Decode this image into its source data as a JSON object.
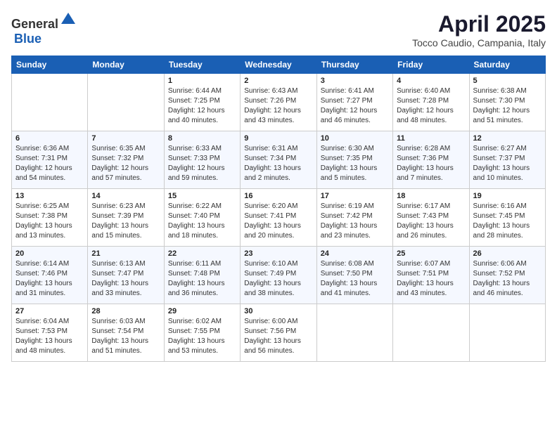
{
  "header": {
    "logo_general": "General",
    "logo_blue": "Blue",
    "month": "April 2025",
    "location": "Tocco Caudio, Campania, Italy"
  },
  "weekdays": [
    "Sunday",
    "Monday",
    "Tuesday",
    "Wednesday",
    "Thursday",
    "Friday",
    "Saturday"
  ],
  "weeks": [
    [
      {
        "day": "",
        "info": ""
      },
      {
        "day": "",
        "info": ""
      },
      {
        "day": "1",
        "info": "Sunrise: 6:44 AM\nSunset: 7:25 PM\nDaylight: 12 hours and 40 minutes."
      },
      {
        "day": "2",
        "info": "Sunrise: 6:43 AM\nSunset: 7:26 PM\nDaylight: 12 hours and 43 minutes."
      },
      {
        "day": "3",
        "info": "Sunrise: 6:41 AM\nSunset: 7:27 PM\nDaylight: 12 hours and 46 minutes."
      },
      {
        "day": "4",
        "info": "Sunrise: 6:40 AM\nSunset: 7:28 PM\nDaylight: 12 hours and 48 minutes."
      },
      {
        "day": "5",
        "info": "Sunrise: 6:38 AM\nSunset: 7:30 PM\nDaylight: 12 hours and 51 minutes."
      }
    ],
    [
      {
        "day": "6",
        "info": "Sunrise: 6:36 AM\nSunset: 7:31 PM\nDaylight: 12 hours and 54 minutes."
      },
      {
        "day": "7",
        "info": "Sunrise: 6:35 AM\nSunset: 7:32 PM\nDaylight: 12 hours and 57 minutes."
      },
      {
        "day": "8",
        "info": "Sunrise: 6:33 AM\nSunset: 7:33 PM\nDaylight: 12 hours and 59 minutes."
      },
      {
        "day": "9",
        "info": "Sunrise: 6:31 AM\nSunset: 7:34 PM\nDaylight: 13 hours and 2 minutes."
      },
      {
        "day": "10",
        "info": "Sunrise: 6:30 AM\nSunset: 7:35 PM\nDaylight: 13 hours and 5 minutes."
      },
      {
        "day": "11",
        "info": "Sunrise: 6:28 AM\nSunset: 7:36 PM\nDaylight: 13 hours and 7 minutes."
      },
      {
        "day": "12",
        "info": "Sunrise: 6:27 AM\nSunset: 7:37 PM\nDaylight: 13 hours and 10 minutes."
      }
    ],
    [
      {
        "day": "13",
        "info": "Sunrise: 6:25 AM\nSunset: 7:38 PM\nDaylight: 13 hours and 13 minutes."
      },
      {
        "day": "14",
        "info": "Sunrise: 6:23 AM\nSunset: 7:39 PM\nDaylight: 13 hours and 15 minutes."
      },
      {
        "day": "15",
        "info": "Sunrise: 6:22 AM\nSunset: 7:40 PM\nDaylight: 13 hours and 18 minutes."
      },
      {
        "day": "16",
        "info": "Sunrise: 6:20 AM\nSunset: 7:41 PM\nDaylight: 13 hours and 20 minutes."
      },
      {
        "day": "17",
        "info": "Sunrise: 6:19 AM\nSunset: 7:42 PM\nDaylight: 13 hours and 23 minutes."
      },
      {
        "day": "18",
        "info": "Sunrise: 6:17 AM\nSunset: 7:43 PM\nDaylight: 13 hours and 26 minutes."
      },
      {
        "day": "19",
        "info": "Sunrise: 6:16 AM\nSunset: 7:45 PM\nDaylight: 13 hours and 28 minutes."
      }
    ],
    [
      {
        "day": "20",
        "info": "Sunrise: 6:14 AM\nSunset: 7:46 PM\nDaylight: 13 hours and 31 minutes."
      },
      {
        "day": "21",
        "info": "Sunrise: 6:13 AM\nSunset: 7:47 PM\nDaylight: 13 hours and 33 minutes."
      },
      {
        "day": "22",
        "info": "Sunrise: 6:11 AM\nSunset: 7:48 PM\nDaylight: 13 hours and 36 minutes."
      },
      {
        "day": "23",
        "info": "Sunrise: 6:10 AM\nSunset: 7:49 PM\nDaylight: 13 hours and 38 minutes."
      },
      {
        "day": "24",
        "info": "Sunrise: 6:08 AM\nSunset: 7:50 PM\nDaylight: 13 hours and 41 minutes."
      },
      {
        "day": "25",
        "info": "Sunrise: 6:07 AM\nSunset: 7:51 PM\nDaylight: 13 hours and 43 minutes."
      },
      {
        "day": "26",
        "info": "Sunrise: 6:06 AM\nSunset: 7:52 PM\nDaylight: 13 hours and 46 minutes."
      }
    ],
    [
      {
        "day": "27",
        "info": "Sunrise: 6:04 AM\nSunset: 7:53 PM\nDaylight: 13 hours and 48 minutes."
      },
      {
        "day": "28",
        "info": "Sunrise: 6:03 AM\nSunset: 7:54 PM\nDaylight: 13 hours and 51 minutes."
      },
      {
        "day": "29",
        "info": "Sunrise: 6:02 AM\nSunset: 7:55 PM\nDaylight: 13 hours and 53 minutes."
      },
      {
        "day": "30",
        "info": "Sunrise: 6:00 AM\nSunset: 7:56 PM\nDaylight: 13 hours and 56 minutes."
      },
      {
        "day": "",
        "info": ""
      },
      {
        "day": "",
        "info": ""
      },
      {
        "day": "",
        "info": ""
      }
    ]
  ]
}
